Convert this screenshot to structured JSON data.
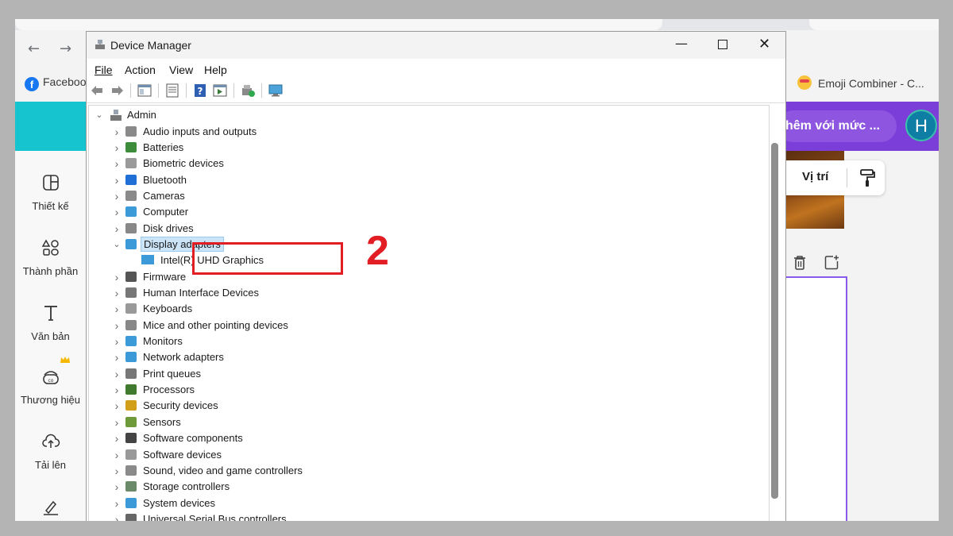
{
  "browser": {
    "bookmarks": [
      {
        "label": "Faceboo"
      },
      {
        "label": "Emoji Combiner - C..."
      }
    ]
  },
  "canva": {
    "header_search": "hêm với mức ...",
    "avatar_letter": "H",
    "sidebar": [
      {
        "label": "Thiết kế",
        "icon": "layout-icon"
      },
      {
        "label": "Thành phần",
        "icon": "elements-icon"
      },
      {
        "label": "Văn bản",
        "icon": "text-icon"
      },
      {
        "label": "Thương hiệu",
        "icon": "brand-icon"
      },
      {
        "label": "Tải lên",
        "icon": "upload-icon"
      },
      {
        "label": "",
        "icon": "draw-icon"
      }
    ],
    "position_label": "Vị trí"
  },
  "device_manager": {
    "title": "Device Manager",
    "menu": [
      "File",
      "Action",
      "View",
      "Help"
    ],
    "root": "Admin",
    "categories": [
      {
        "label": "Audio inputs and outputs",
        "icon": "speaker-icon"
      },
      {
        "label": "Batteries",
        "icon": "battery-icon"
      },
      {
        "label": "Biometric devices",
        "icon": "fingerprint-icon"
      },
      {
        "label": "Bluetooth",
        "icon": "bluetooth-icon"
      },
      {
        "label": "Cameras",
        "icon": "camera-icon"
      },
      {
        "label": "Computer",
        "icon": "computer-icon"
      },
      {
        "label": "Disk drives",
        "icon": "disk-icon"
      },
      {
        "label": "Display adapters",
        "icon": "display-adapter-icon",
        "expanded": true,
        "selected": true
      },
      {
        "label": "Firmware",
        "icon": "firmware-icon"
      },
      {
        "label": "Human Interface Devices",
        "icon": "hid-icon"
      },
      {
        "label": "Keyboards",
        "icon": "keyboard-icon"
      },
      {
        "label": "Mice and other pointing devices",
        "icon": "mouse-icon"
      },
      {
        "label": "Monitors",
        "icon": "monitor-icon"
      },
      {
        "label": "Network adapters",
        "icon": "network-icon"
      },
      {
        "label": "Print queues",
        "icon": "printer-icon"
      },
      {
        "label": "Processors",
        "icon": "processor-icon"
      },
      {
        "label": "Security devices",
        "icon": "security-icon"
      },
      {
        "label": "Sensors",
        "icon": "sensor-icon"
      },
      {
        "label": "Software components",
        "icon": "software-component-icon"
      },
      {
        "label": "Software devices",
        "icon": "software-device-icon"
      },
      {
        "label": "Sound, video and game controllers",
        "icon": "sound-icon"
      },
      {
        "label": "Storage controllers",
        "icon": "storage-icon"
      },
      {
        "label": "System devices",
        "icon": "system-icon"
      },
      {
        "label": "Universal Serial Bus controllers",
        "icon": "usb-icon"
      }
    ],
    "display_child": "Intel(R) UHD Graphics"
  },
  "annotation": {
    "step": "2",
    "color": "#e21d24"
  }
}
